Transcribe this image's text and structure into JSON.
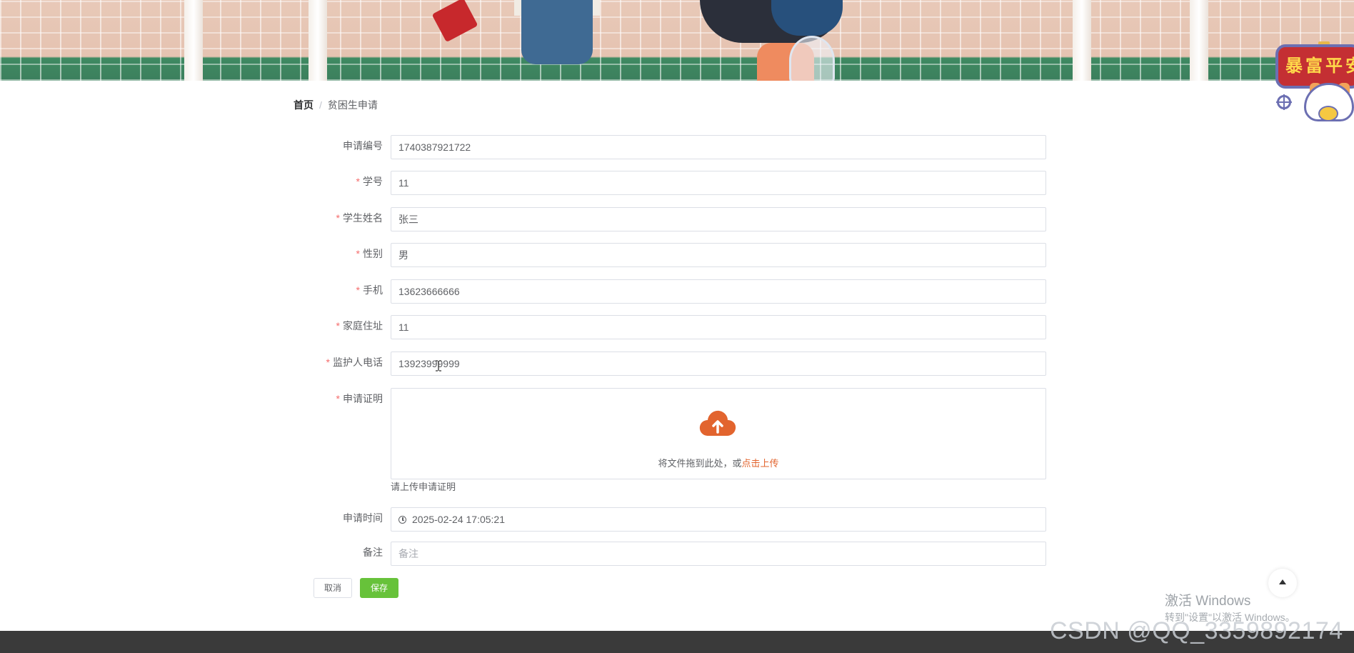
{
  "banner": {
    "sticker_text": "暴富平安"
  },
  "breadcrumb": {
    "home": "首页",
    "separator": "/",
    "current": "贫困生申请"
  },
  "form": {
    "fields": [
      {
        "key": "apply_no",
        "label": "申请编号",
        "required": false,
        "value": "1740387921722"
      },
      {
        "key": "student_no",
        "label": "学号",
        "required": true,
        "value": "11"
      },
      {
        "key": "student_name",
        "label": "学生姓名",
        "required": true,
        "value": "张三"
      },
      {
        "key": "gender",
        "label": "性别",
        "required": true,
        "value": "男"
      },
      {
        "key": "phone",
        "label": "手机",
        "required": true,
        "value": "13623666666"
      },
      {
        "key": "address",
        "label": "家庭住址",
        "required": true,
        "value": "11"
      },
      {
        "key": "guardian_phone",
        "label": "监护人电话",
        "required": true,
        "value": "13923999999"
      }
    ],
    "proof": {
      "label": "申请证明",
      "required": true,
      "upload_text": "将文件拖到此处，或",
      "upload_link": "点击上传",
      "tip": "请上传申请证明",
      "icon": "cloud-upload-icon",
      "icon_color": "#e2642e"
    },
    "apply_time": {
      "label": "申请时间",
      "value": "2025-02-24 17:05:21",
      "icon": "clock-icon"
    },
    "remark": {
      "label": "备注",
      "placeholder": "备注"
    },
    "required_mark": "*"
  },
  "actions": {
    "cancel_label": "取消",
    "save_label": "保存",
    "save_color": "#67c23a"
  },
  "watermarks": {
    "windows_title": "激活 Windows",
    "windows_sub": "转到\"设置\"以激活 Windows。",
    "csdn": "CSDN @QQ_3359892174"
  }
}
